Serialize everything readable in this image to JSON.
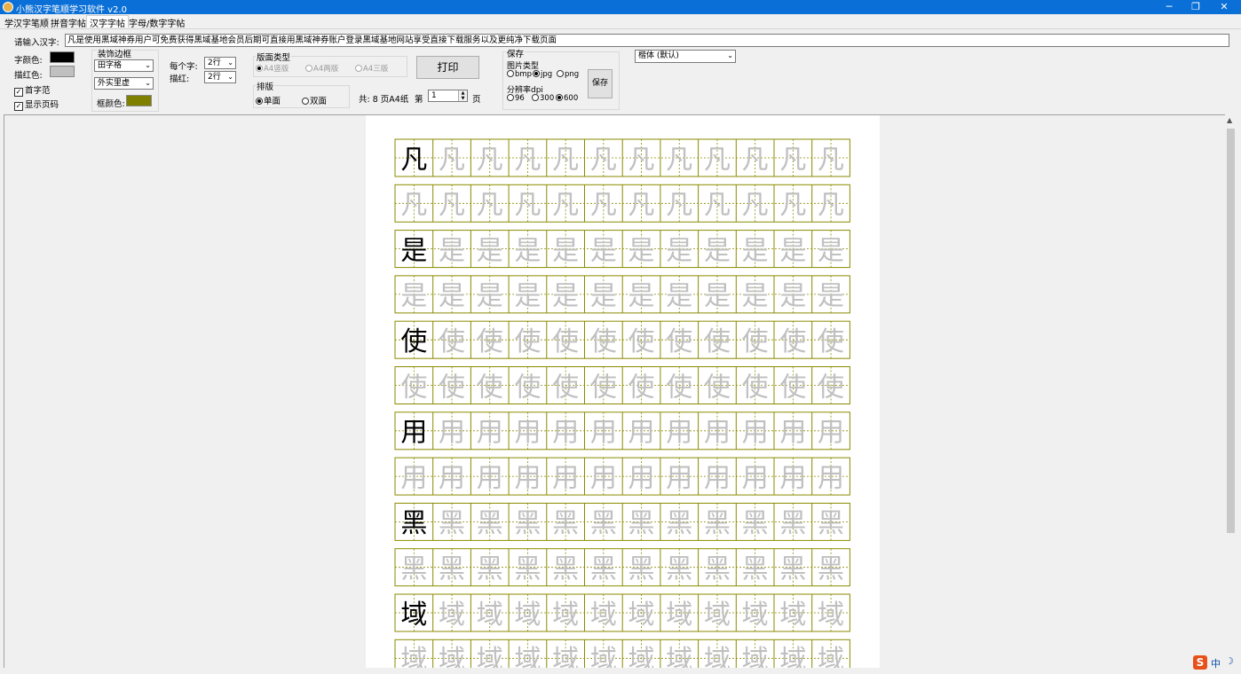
{
  "window": {
    "title": "小熊汉字笔顺学习软件 v2.0"
  },
  "tabs": [
    {
      "label": "学汉字笔顺",
      "active": false
    },
    {
      "label": "拼音字帖",
      "active": false
    },
    {
      "label": "汉字字帖",
      "active": true
    },
    {
      "label": "字母/数字字帖",
      "active": false
    }
  ],
  "input": {
    "label": "请输入汉字:",
    "value": "凡是使用黑域神券用户可免费获得黑域基地会员后期可直接用黑域神券账户登录黑域基地网站享受直接下载服务以及更纯净下载页面"
  },
  "colors": {
    "char_color_label": "字颜色:",
    "char_color": "#000000",
    "trace_color_label": "描红色:",
    "trace_color": "#c0c0c0",
    "grid_color": "#8a8a00"
  },
  "checkboxes": {
    "first_char_example": {
      "label": "首字范",
      "checked": true
    },
    "show_page_number": {
      "label": "显示页码",
      "checked": true
    }
  },
  "decoration": {
    "title": "装饰边框",
    "grid_type": "田字格",
    "border_style": "外实里虚",
    "frame_color_label": "框颜色:",
    "frame_color": "#808000"
  },
  "per_char": {
    "label": "每个字:",
    "value": "2行"
  },
  "trace": {
    "label": "描红:",
    "value": "2行"
  },
  "layout_type": {
    "title": "版面类型",
    "options": [
      "A4竖版",
      "A4两版",
      "A4三版"
    ],
    "selected": 0
  },
  "print_button": "打印",
  "arrange": {
    "title": "排版",
    "options": [
      "单面",
      "双面"
    ],
    "selected": 0
  },
  "pages": {
    "total_label": "共: 8 页A4纸",
    "page_prefix": "第",
    "page_value": "1",
    "page_suffix": "页"
  },
  "save": {
    "title": "保存",
    "image_type_label": "图片类型",
    "image_types": [
      "bmp",
      "jpg",
      "png"
    ],
    "image_type_selected": 1,
    "dpi_label": "分辨率dpi",
    "dpi_options": [
      "96",
      "300",
      "600"
    ],
    "dpi_selected": 2,
    "button": "保存"
  },
  "font_select": "楷体 (默认)",
  "worksheet": {
    "chars": [
      "凡",
      "是",
      "使",
      "用",
      "黑",
      "域"
    ],
    "columns": 12
  },
  "tray": {
    "ime_label": "中"
  }
}
